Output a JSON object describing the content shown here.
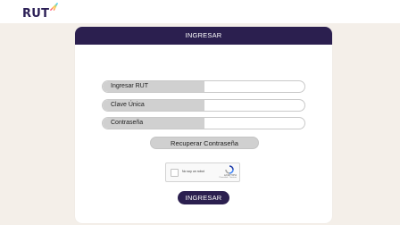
{
  "brand": {
    "logo_text": "RUT"
  },
  "card": {
    "header_title": "INGRESAR"
  },
  "form": {
    "fields": [
      {
        "label": "Ingresar RUT",
        "value": ""
      },
      {
        "label": "Clave Única",
        "value": ""
      },
      {
        "label": "Contraseña",
        "value": ""
      }
    ],
    "recover_label": "Recuperar Contraseña",
    "submit_label": "INGRESAR"
  },
  "captcha": {
    "checkbox_label": "No soy un robot",
    "brand_text": "reCAPTCHA",
    "terms_text": "Privacidad - Términos"
  },
  "colors": {
    "primary": "#2b1f4f",
    "background": "#f4efe9",
    "field_label_bg": "#d0d0d0",
    "logo_spark_gradient": [
      "#ff4a7d",
      "#ffd23f",
      "#3fd2ff"
    ]
  }
}
